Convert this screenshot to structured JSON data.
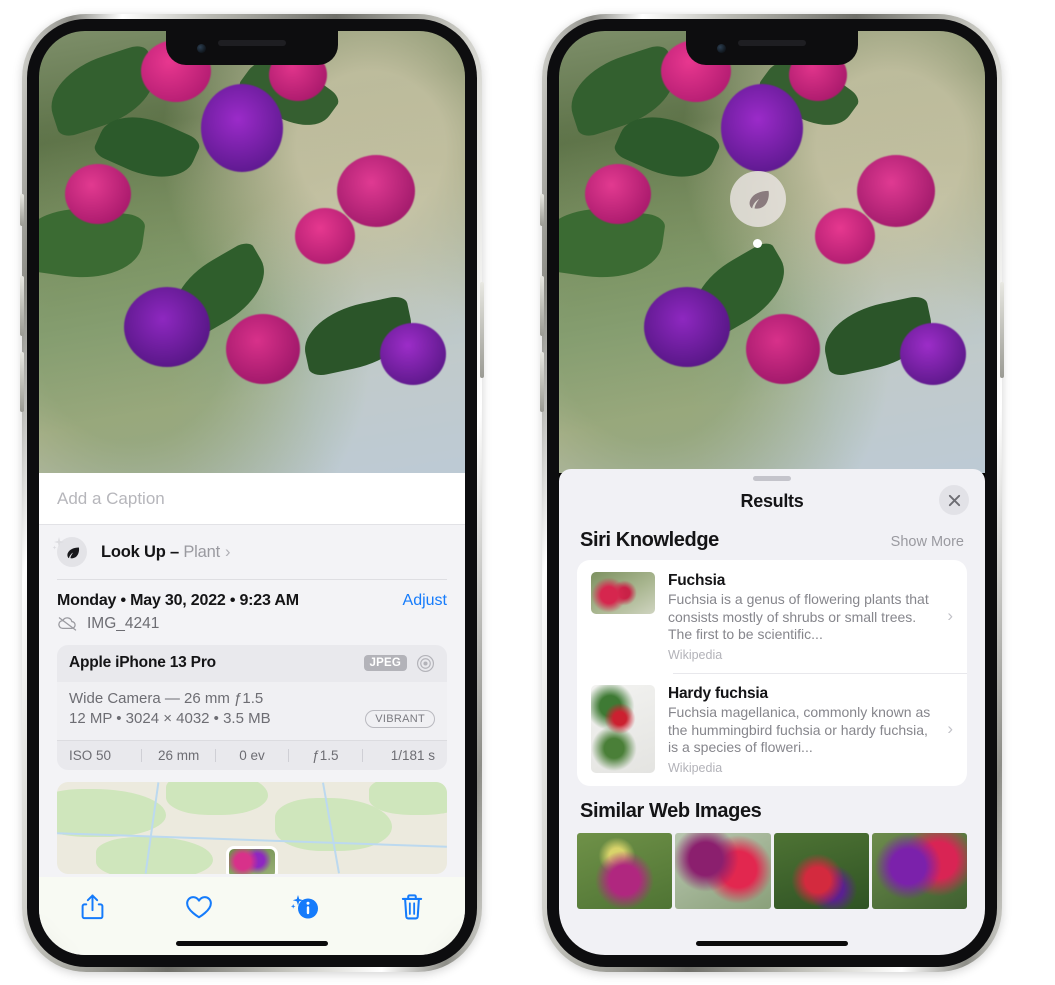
{
  "left_phone": {
    "caption": {
      "placeholder": "Add a Caption",
      "value": ""
    },
    "lookup": {
      "label": "Look Up – ",
      "subject": "Plant",
      "chevron": "›",
      "icon": "leaf-icon"
    },
    "date": {
      "text": "Monday • May 30, 2022 • 9:23 AM",
      "adjust_label": "Adjust"
    },
    "file": {
      "name": "IMG_4241",
      "icon": "cloud-slash-icon"
    },
    "exif": {
      "device": "Apple iPhone 13 Pro",
      "format_badge": "JPEG",
      "aperture_icon": "aperture-icon",
      "lens_line": "Wide Camera — 26 mm ƒ1.5",
      "size_line": "12 MP • 3024 × 4032 • 3.5 MB",
      "quality_badge": "VIBRANT",
      "stats": [
        "ISO 50",
        "26 mm",
        "0 ev",
        "ƒ1.5",
        "1/181 s"
      ]
    },
    "toolbar": [
      {
        "name": "share-button",
        "icon": "share-icon"
      },
      {
        "name": "favorite-button",
        "icon": "heart-icon"
      },
      {
        "name": "info-button",
        "icon": "info-sparkle-icon"
      },
      {
        "name": "delete-button",
        "icon": "trash-icon"
      }
    ]
  },
  "right_phone": {
    "badge": {
      "icon": "leaf-icon"
    },
    "sheet": {
      "title": "Results",
      "close_icon": "close-icon",
      "grabber": "drag-handle"
    },
    "siri_knowledge": {
      "title": "Siri Knowledge",
      "show_more": "Show More",
      "items": [
        {
          "title": "Fuchsia",
          "desc": "Fuchsia is a genus of flowering plants that consists mostly of shrubs or small trees. The first to be scientific...",
          "source": "Wikipedia",
          "chevron": "›"
        },
        {
          "title": "Hardy fuchsia",
          "desc": "Fuchsia magellanica, commonly known as the hummingbird fuchsia or hardy fuchsia, is a species of floweri...",
          "source": "Wikipedia",
          "chevron": "›"
        }
      ]
    },
    "similar_web_images": {
      "title": "Similar Web Images",
      "count": 4
    }
  },
  "colors": {
    "accent_blue": "#157bfb",
    "sheet_bg": "#f3f3f6",
    "card_bg": "#e9e9ed",
    "text_primary": "#141416",
    "text_secondary": "#6d6d73",
    "text_tertiary": "#b2b2b8"
  }
}
